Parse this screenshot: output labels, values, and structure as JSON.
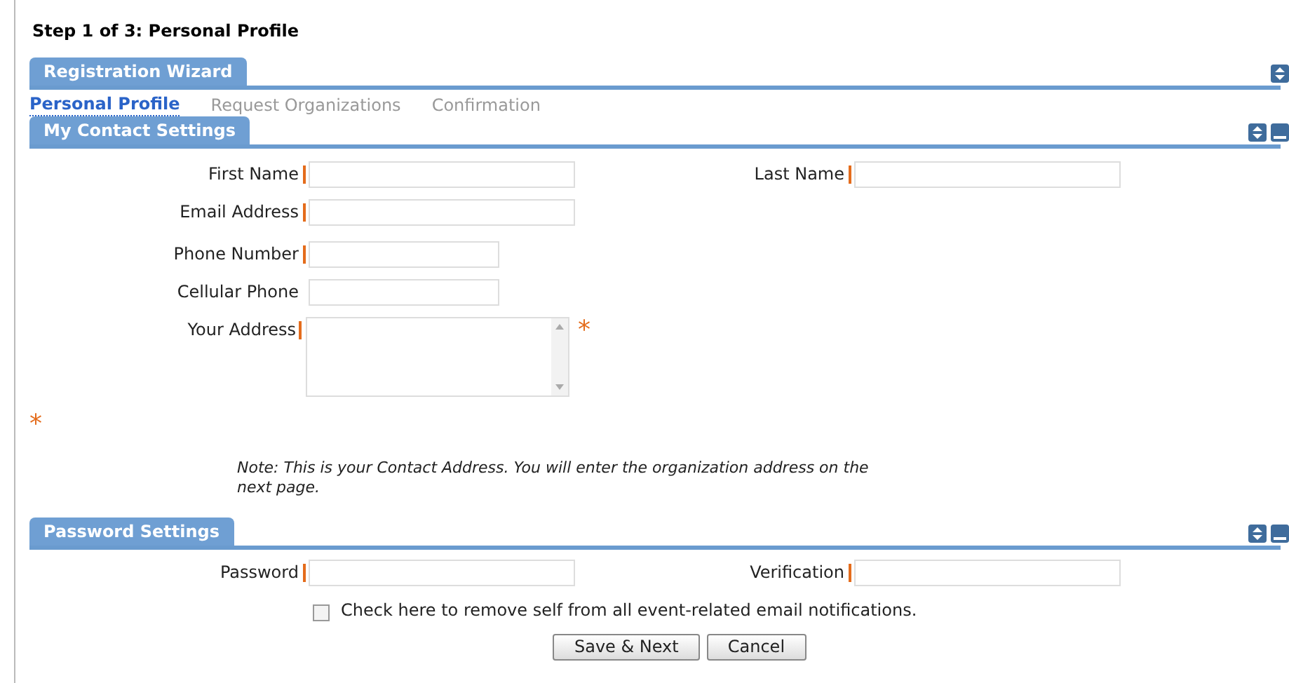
{
  "page_title": "Step 1 of 3: Personal Profile",
  "wizard": {
    "title": "Registration Wizard",
    "collapsible": false,
    "steps": [
      {
        "label": "Personal Profile",
        "selected": true
      },
      {
        "label": "Request Organizations",
        "selected": false
      },
      {
        "label": "Confirmation",
        "selected": false
      }
    ]
  },
  "contact_settings": {
    "title": "My Contact Settings",
    "collapsible": true,
    "left_fields": [
      {
        "label": "First Name",
        "required": true,
        "kind": "long"
      },
      {
        "label": "Email Address",
        "required": true,
        "kind": "long"
      },
      {
        "label": "Phone Number",
        "required": true,
        "kind": "short"
      },
      {
        "label": "Cellular Phone",
        "required": false,
        "kind": "short"
      },
      {
        "label": "Your Address",
        "required": true,
        "kind": "textarea",
        "marker": "*"
      }
    ],
    "right_fields": [
      {
        "label": "Last Name",
        "required": true,
        "kind": "long"
      }
    ],
    "required_note": "*",
    "note": "Note: This is your Contact Address. You will enter the organization address on the next page."
  },
  "password_settings": {
    "title": "Password Settings",
    "collapsible": true,
    "fields": [
      {
        "label": "Password",
        "required": true,
        "kind": "long"
      },
      {
        "label": "Verification",
        "required": true,
        "kind": "long"
      }
    ],
    "checkbox": {
      "label": "Check here to remove self from all event-related email notifications.",
      "checked": false
    }
  },
  "buttons": [
    "Save & Next",
    "Cancel"
  ]
}
